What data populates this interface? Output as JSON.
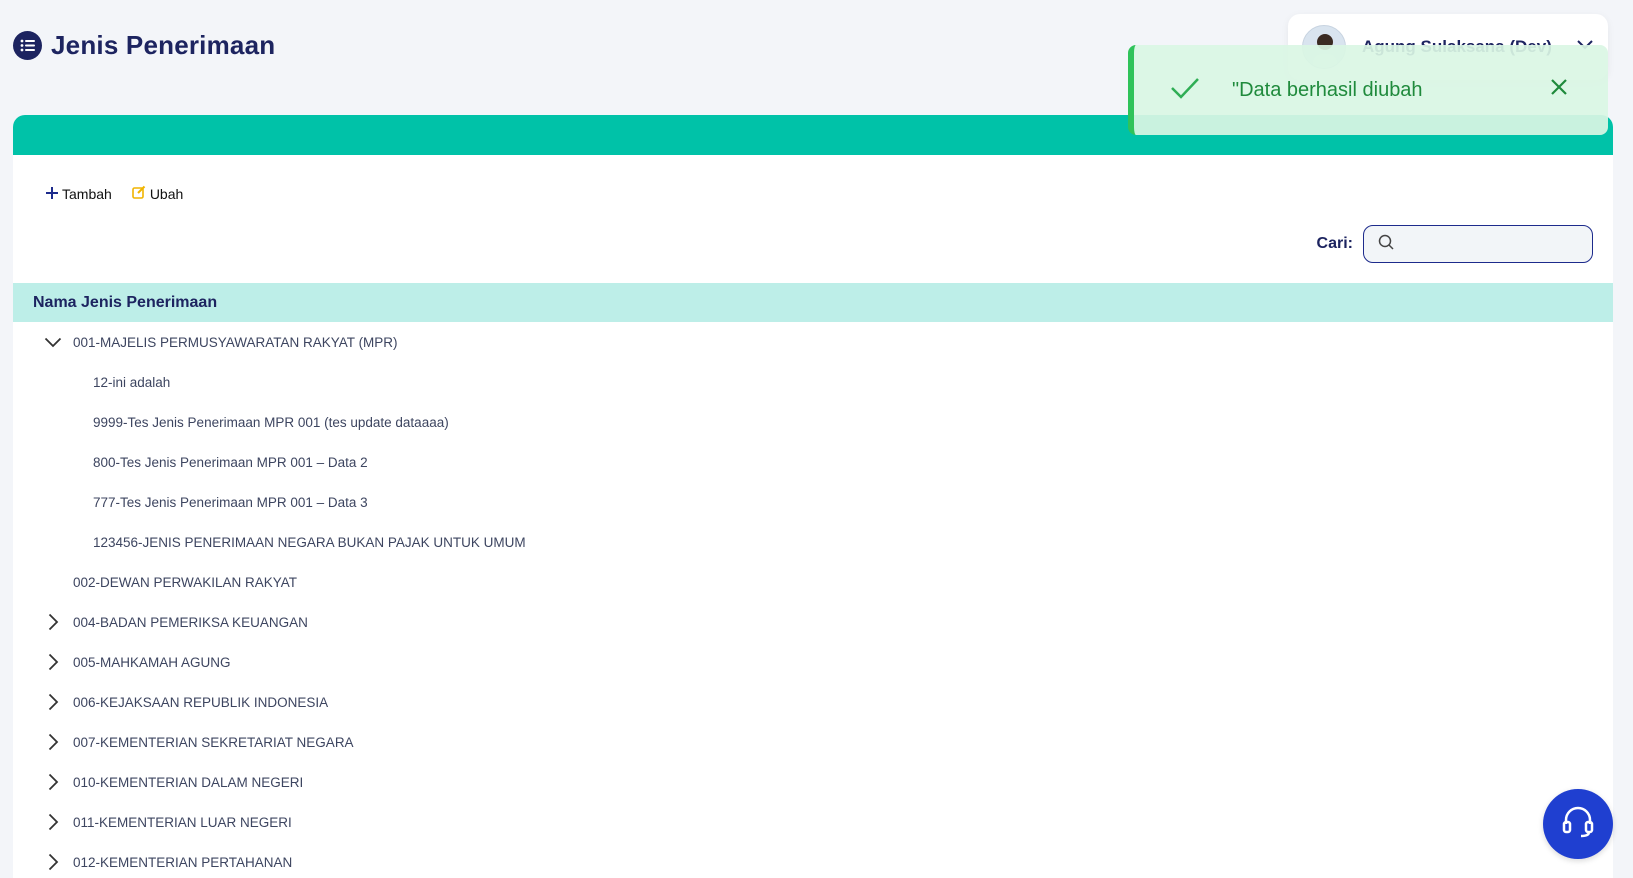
{
  "header": {
    "title": "Jenis Penerimaan",
    "icon": "list-icon"
  },
  "user": {
    "name": "Agung Sulaksana (Dev)"
  },
  "toolbar": {
    "add_label": "Tambah",
    "edit_label": "Ubah"
  },
  "search": {
    "label": "Cari:",
    "placeholder": "",
    "value": ""
  },
  "table": {
    "column_header": "Nama Jenis Penerimaan"
  },
  "tree": [
    {
      "label": "001-MAJELIS PERMUSYAWARATAN RAKYAT (MPR)",
      "state": "expanded",
      "children": [
        {
          "label": "12-ini adalah"
        },
        {
          "label": "9999-Tes Jenis Penerimaan MPR 001 (tes update dataaaa)"
        },
        {
          "label": "800-Tes Jenis Penerimaan MPR 001 – Data 2"
        },
        {
          "label": "777-Tes Jenis Penerimaan MPR 001 – Data 3"
        },
        {
          "label": "123456-JENIS PENERIMAAN NEGARA BUKAN PAJAK UNTUK UMUM"
        }
      ]
    },
    {
      "label": "002-DEWAN PERWAKILAN RAKYAT",
      "state": "leaf"
    },
    {
      "label": "004-BADAN PEMERIKSA KEUANGAN",
      "state": "collapsed"
    },
    {
      "label": "005-MAHKAMAH AGUNG",
      "state": "collapsed"
    },
    {
      "label": "006-KEJAKSAAN REPUBLIK INDONESIA",
      "state": "collapsed"
    },
    {
      "label": "007-KEMENTERIAN SEKRETARIAT NEGARA",
      "state": "collapsed"
    },
    {
      "label": "010-KEMENTERIAN DALAM NEGERI",
      "state": "collapsed"
    },
    {
      "label": "011-KEMENTERIAN LUAR NEGERI",
      "state": "collapsed"
    },
    {
      "label": "012-KEMENTERIAN PERTAHANAN",
      "state": "collapsed"
    }
  ],
  "toast": {
    "message": "\"Data berhasil diubah",
    "type": "success"
  },
  "colors": {
    "accent": "#00c2a8",
    "primary": "#1d2460",
    "header_row": "#bdeee8",
    "success": "#2fc35a",
    "fab": "#1f3fd0"
  }
}
